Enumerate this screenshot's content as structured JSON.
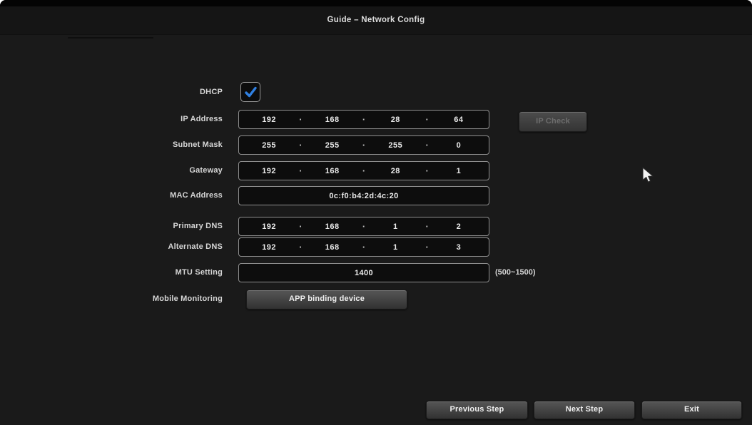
{
  "title": "Guide – Network Config",
  "accent_color": "#2f7fe0",
  "octet_separator": "·",
  "form": {
    "dhcp": {
      "label": "DHCP",
      "checked": true
    },
    "ip_check_button": "IP Check",
    "rows": [
      {
        "label": "IP Address",
        "type": "octets",
        "values": [
          "192",
          "168",
          "28",
          "64"
        ]
      },
      {
        "label": "Subnet Mask",
        "type": "octets",
        "values": [
          "255",
          "255",
          "255",
          "0"
        ]
      },
      {
        "label": "Gateway",
        "type": "octets",
        "values": [
          "192",
          "168",
          "28",
          "1"
        ]
      },
      {
        "label": "MAC Address",
        "type": "text",
        "value": "0c:f0:b4:2d:4c:20"
      },
      {
        "label": "Primary DNS",
        "type": "octets",
        "values": [
          "192",
          "168",
          "1",
          "2"
        ]
      },
      {
        "label": "Alternate DNS",
        "type": "octets",
        "values": [
          "192",
          "168",
          "1",
          "3"
        ]
      },
      {
        "label": "MTU Setting",
        "type": "text",
        "value": "1400",
        "hint": "(500~1500)"
      },
      {
        "label": "Mobile Monitoring",
        "type": "button",
        "button_label": "APP binding device"
      }
    ]
  },
  "footer": {
    "previous_label": "Previous Step",
    "next_label": "Next Step",
    "exit_label": "Exit"
  }
}
